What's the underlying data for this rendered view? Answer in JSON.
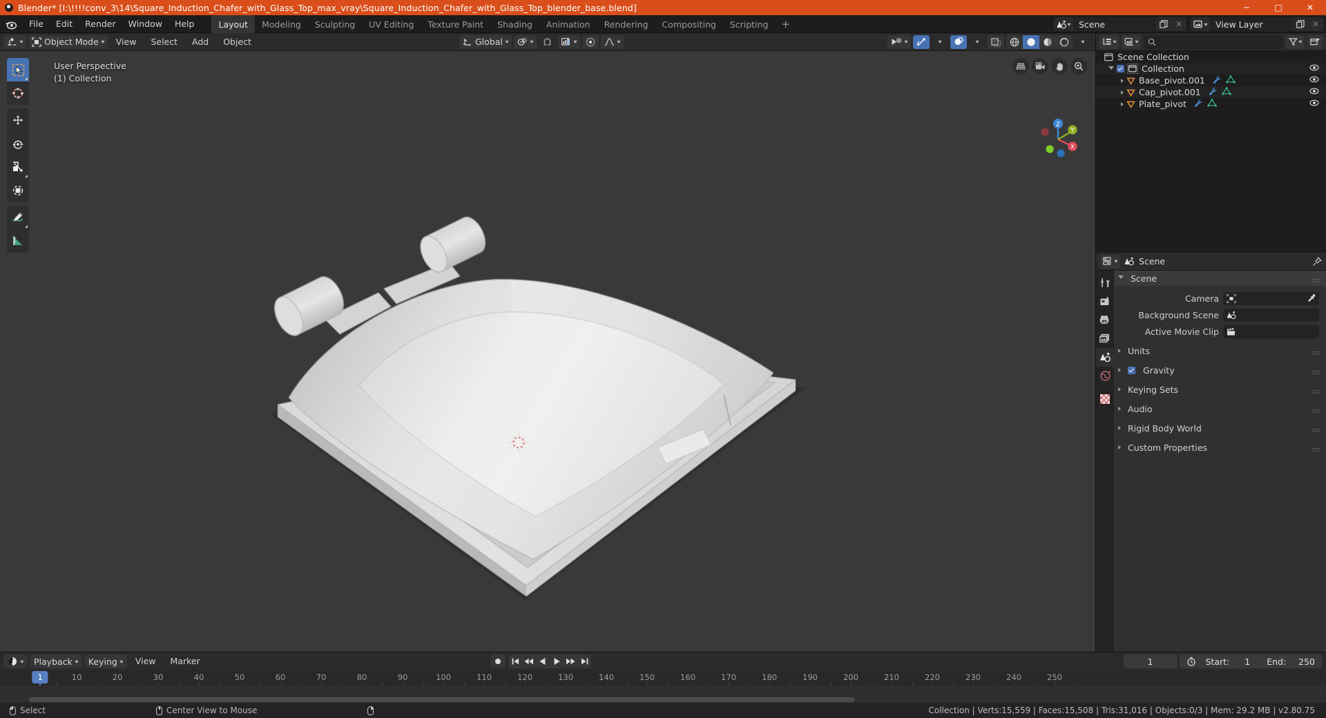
{
  "window": {
    "title": "Blender* [I:\\!!!!conv_3\\14\\Square_Induction_Chafer_with_Glass_Top_max_vray\\Square_Induction_Chafer_with_Glass_Top_blender_base.blend]",
    "minimize": "─",
    "maximize": "□",
    "close": "✕",
    "title_bar_color": "#d94e1a"
  },
  "menubar": {
    "items": [
      "File",
      "Edit",
      "Render",
      "Window",
      "Help"
    ]
  },
  "workspace_tabs": {
    "tabs": [
      "Layout",
      "Modeling",
      "Sculpting",
      "UV Editing",
      "Texture Paint",
      "Shading",
      "Animation",
      "Rendering",
      "Compositing",
      "Scripting"
    ],
    "active": "Layout",
    "add_label": "+"
  },
  "topbar_right": {
    "scene_icon": "scene-icon",
    "scene_value": "Scene",
    "scene_new_icon": "duplicate-icon",
    "scene_unlink_icon": "close-icon",
    "viewlayer_icon": "viewlayer-icon",
    "viewlayer_value": "View Layer",
    "viewlayer_new_icon": "duplicate-icon",
    "viewlayer_unlink_icon": "close-icon",
    "search_icon": "search-icon"
  },
  "viewport_header": {
    "editor_type_icon": "editor-type-3dview-icon",
    "mode_icon": "object-mode-icon",
    "mode_label": "Object Mode",
    "menus": [
      "View",
      "Select",
      "Add",
      "Object"
    ],
    "transform_orientation_icon": "orientation-icon",
    "transform_orientation": "Global",
    "snap_magnet_icon": "magnet-icon",
    "pivot_icon": "pivot-icon",
    "snap_target_icon": "snap-target-icon",
    "proportional_icon": "proportional-edit-icon",
    "falloff_icon": "falloff-curve-icon",
    "visibility_icon": "visibility-eye-icon",
    "gizmo_icon": "gizmo-icon",
    "overlays_icon": "overlays-icon",
    "xray_icon": "xray-toggle-icon",
    "shading_modes": [
      "wireframe",
      "solid",
      "material-preview",
      "rendered"
    ],
    "shading_active": "solid"
  },
  "viewport": {
    "perspective_label": "User Perspective",
    "collection_label": "(1) Collection",
    "background_color": "#393939",
    "grid_color": "#4b4b4b",
    "x_axis_color": "#b44044",
    "y_axis_color": "#7a9b2f",
    "toolbar": [
      {
        "name": "select-box-tool",
        "active": true
      },
      {
        "name": "cursor-tool",
        "active": false
      },
      {
        "name": "move-tool",
        "active": false
      },
      {
        "name": "rotate-tool",
        "active": false
      },
      {
        "name": "scale-tool",
        "active": false
      },
      {
        "name": "transform-tool",
        "active": false
      },
      {
        "name": "annotate-tool",
        "active": false
      },
      {
        "name": "measure-tool",
        "active": false
      }
    ],
    "nav_buttons": [
      "grid-ortho-toggle-icon",
      "camera-view-icon",
      "pan-hand-icon",
      "zoom-magnifier-icon"
    ],
    "gizmo_axes": [
      {
        "label": "Z",
        "color": "#3b86d4"
      },
      {
        "label": "Y",
        "color": "#93b126"
      },
      {
        "label": "X",
        "color": "#e04a5a"
      }
    ]
  },
  "outliner": {
    "display_mode_icon": "outliner-display-mode-icon",
    "filter_id_icon": "filter-id-icon",
    "search_placeholder": "",
    "search_icon": "search-icon",
    "filter_icon": "filter-funnel-icon",
    "new_collection_icon": "new-collection-icon",
    "rows": [
      {
        "label": "Scene Collection",
        "icon": "scene-collection-icon",
        "indent": 0,
        "has_eye": false,
        "has_checkbox": false,
        "has_triangle": false,
        "modifiers": []
      },
      {
        "label": "Collection",
        "icon": "collection-icon",
        "indent": 1,
        "has_eye": true,
        "has_checkbox": true,
        "has_triangle": true,
        "expanded": true,
        "modifiers": []
      },
      {
        "label": "Base_pivot.001",
        "icon": "empty-object-icon",
        "indent": 2,
        "has_eye": true,
        "has_checkbox": false,
        "has_triangle": true,
        "expanded": false,
        "modifiers": [
          "modifier-wrench-icon",
          "mesh-data-icon"
        ]
      },
      {
        "label": "Cap_pivot.001",
        "icon": "empty-object-icon",
        "indent": 2,
        "has_eye": true,
        "has_checkbox": false,
        "has_triangle": true,
        "expanded": false,
        "modifiers": [
          "modifier-wrench-icon",
          "mesh-data-icon"
        ]
      },
      {
        "label": "Plate_pivot",
        "icon": "empty-object-icon",
        "indent": 2,
        "has_eye": true,
        "has_checkbox": false,
        "has_triangle": true,
        "expanded": false,
        "modifiers": [
          "modifier-wrench-icon",
          "mesh-data-icon"
        ]
      }
    ]
  },
  "properties": {
    "editor_icon": "properties-editor-icon",
    "breadcrumb_icon": "scene-icon",
    "breadcrumb": "Scene",
    "pin_icon": "pin-icon",
    "tabs": [
      {
        "name": "tool-tab",
        "icon": "tool-screwdriver-wrench-icon",
        "active": false
      },
      {
        "name": "render-tab",
        "icon": "render-camera-back-icon",
        "active": false
      },
      {
        "name": "output-tab",
        "icon": "output-printer-icon",
        "active": false
      },
      {
        "name": "viewlayer-tab",
        "icon": "viewlayer-images-icon",
        "active": false
      },
      {
        "name": "scene-tab",
        "icon": "scene-cone-sphere-icon",
        "active": true
      },
      {
        "name": "world-tab",
        "icon": "world-globe-icon",
        "active": false
      },
      {
        "name": "texture-tab",
        "icon": "texture-checker-icon",
        "active": false
      }
    ],
    "panels": [
      {
        "label": "Scene",
        "open": true,
        "type": "header"
      },
      {
        "label": "Units",
        "open": false,
        "type": "closed"
      },
      {
        "label": "Gravity",
        "open": false,
        "type": "closed",
        "checkbox": true
      },
      {
        "label": "Keying Sets",
        "open": false,
        "type": "closed"
      },
      {
        "label": "Audio",
        "open": false,
        "type": "closed"
      },
      {
        "label": "Rigid Body World",
        "open": false,
        "type": "closed"
      },
      {
        "label": "Custom Properties",
        "open": false,
        "type": "closed"
      }
    ],
    "scene_fields": [
      {
        "label": "Camera",
        "icon": "camera-data-icon",
        "value": "",
        "has_eyedropper": true
      },
      {
        "label": "Background Scene",
        "icon": "scene-icon",
        "value": "",
        "has_eyedropper": false
      },
      {
        "label": "Active Movie Clip",
        "icon": "clapperboard-icon",
        "value": "",
        "has_eyedropper": false
      }
    ]
  },
  "timeline": {
    "editor_icon": "timeline-editor-icon",
    "menus": [
      "Playback",
      "Keying",
      "View",
      "Marker"
    ],
    "record_icon": "auto-keying-record-icon",
    "transport": [
      "jump-to-start-icon",
      "jump-prev-keyframe-icon",
      "play-reverse-icon",
      "play-icon",
      "jump-next-keyframe-icon",
      "jump-to-end-icon"
    ],
    "current_frame": "1",
    "timer_icon": "use-preview-range-icon",
    "start_label": "Start:",
    "start_value": "1",
    "end_label": "End:",
    "end_value": "250",
    "ruler_ticks": [
      "1",
      "10",
      "20",
      "30",
      "40",
      "50",
      "60",
      "70",
      "80",
      "90",
      "100",
      "110",
      "120",
      "130",
      "140",
      "150",
      "160",
      "170",
      "180",
      "190",
      "200",
      "210",
      "220",
      "230",
      "240",
      "250"
    ],
    "playhead_frame": "1",
    "playhead_color": "#5680c2"
  },
  "statusbar": {
    "items": [
      {
        "icon": "mouse-left-icon",
        "label": "Select"
      },
      {
        "icon": "mouse-middle-icon",
        "label": "Center View to Mouse"
      },
      {
        "icon": "mouse-right-icon",
        "label": ""
      }
    ],
    "stats": "Collection | Verts:15,559 | Faces:15,508 | Tris:31,016 | Objects:0/3 | Mem: 29.2 MB | v2.80.75"
  }
}
